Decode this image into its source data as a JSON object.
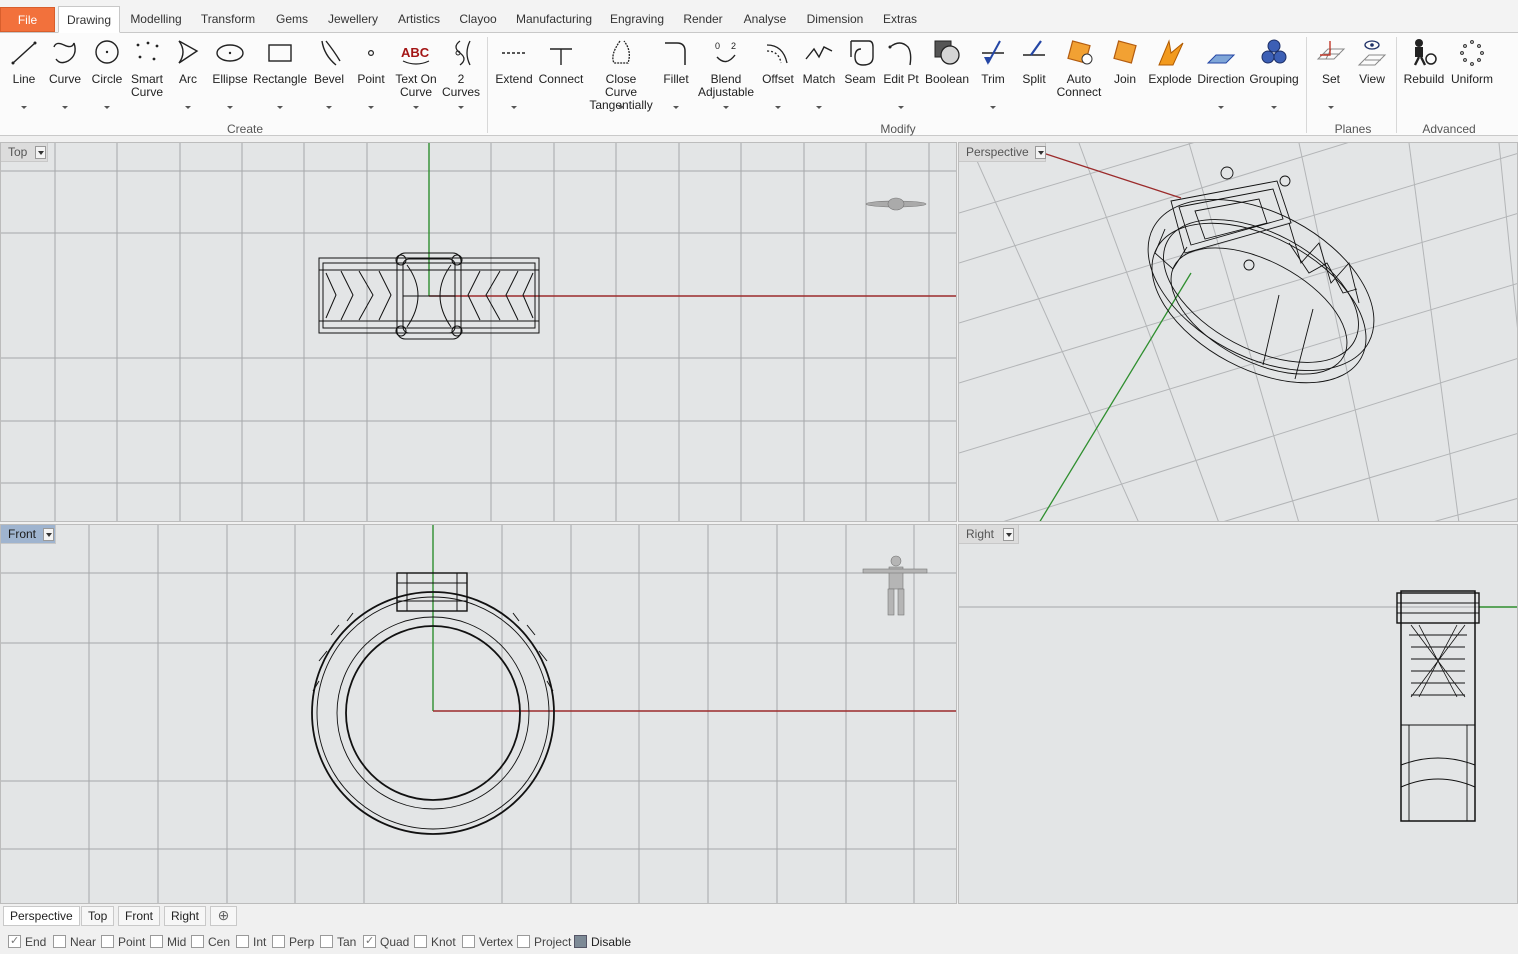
{
  "menu_tabs": [
    "File",
    "Drawing",
    "Modelling",
    "Transform",
    "Gems",
    "Jewellery",
    "Artistics",
    "Clayoo",
    "Manufacturing",
    "Engraving",
    "Render",
    "Analyse",
    "Dimension",
    "Extras"
  ],
  "active_menu_tab": "Drawing",
  "ribbon": {
    "create_buttons": [
      {
        "label": "Line",
        "icon": "line-icon"
      },
      {
        "label": "Curve",
        "icon": "curve-icon"
      },
      {
        "label": "Circle",
        "icon": "circle-icon"
      },
      {
        "label": "Smart\nCurve",
        "icon": "smart-curve-icon"
      },
      {
        "label": "Arc",
        "icon": "arc-icon"
      },
      {
        "label": "Ellipse",
        "icon": "ellipse-icon"
      },
      {
        "label": "Rectangle",
        "icon": "rectangle-icon"
      },
      {
        "label": "Bevel",
        "icon": "bevel-icon"
      },
      {
        "label": "Point",
        "icon": "point-icon"
      },
      {
        "label": "Text On\nCurve",
        "icon": "text-on-curve-icon"
      },
      {
        "label": "2\nCurves",
        "icon": "two-curves-icon"
      }
    ],
    "modify_buttons": [
      {
        "label": "Extend",
        "icon": "extend-icon"
      },
      {
        "label": "Connect",
        "icon": "connect-icon"
      },
      {
        "label": "Close Curve\nTangentially",
        "icon": "close-curve-icon"
      },
      {
        "label": "Fillet",
        "icon": "fillet-icon"
      },
      {
        "label": "Blend\nAdjustable",
        "icon": "blend-icon"
      },
      {
        "label": "Offset",
        "icon": "offset-icon"
      },
      {
        "label": "Match",
        "icon": "match-icon"
      },
      {
        "label": "Seam",
        "icon": "seam-icon"
      },
      {
        "label": "Edit Pt",
        "icon": "edit-point-icon"
      },
      {
        "label": "Boolean",
        "icon": "boolean-icon"
      },
      {
        "label": "Trim",
        "icon": "trim-icon"
      },
      {
        "label": "Split",
        "icon": "split-icon"
      },
      {
        "label": "Auto\nConnect",
        "icon": "auto-connect-icon"
      },
      {
        "label": "Join",
        "icon": "join-icon"
      },
      {
        "label": "Explode",
        "icon": "explode-icon"
      },
      {
        "label": "Direction",
        "icon": "direction-icon"
      },
      {
        "label": "Grouping",
        "icon": "grouping-icon"
      }
    ],
    "planes_buttons": [
      {
        "label": "Set",
        "icon": "set-plane-icon"
      },
      {
        "label": "View",
        "icon": "view-plane-icon"
      }
    ],
    "advanced_buttons": [
      {
        "label": "Rebuild",
        "icon": "rebuild-icon"
      },
      {
        "label": "Uniform",
        "icon": "uniform-icon"
      }
    ],
    "groups": [
      "Create",
      "Modify",
      "Planes",
      "Advanced"
    ]
  },
  "viewports": {
    "top": "Top",
    "perspective": "Perspective",
    "front": "Front",
    "right": "Right",
    "active": "Front"
  },
  "bottom_tabs": [
    "Perspective",
    "Top",
    "Front",
    "Right"
  ],
  "add_tab_icon": "add-tab-icon",
  "osnaps": [
    {
      "label": "End",
      "checked": true
    },
    {
      "label": "Near",
      "checked": false
    },
    {
      "label": "Point",
      "checked": false
    },
    {
      "label": "Mid",
      "checked": false
    },
    {
      "label": "Cen",
      "checked": false
    },
    {
      "label": "Int",
      "checked": false
    },
    {
      "label": "Perp",
      "checked": false
    },
    {
      "label": "Tan",
      "checked": false
    },
    {
      "label": "Quad",
      "checked": true
    },
    {
      "label": "Knot",
      "checked": false
    },
    {
      "label": "Vertex",
      "checked": false
    },
    {
      "label": "Project",
      "checked": false
    },
    {
      "label": "Disable",
      "checked": false
    }
  ],
  "colors": {
    "file_tab": "#f2713c",
    "x_axis": "#9b2b2b",
    "y_axis": "#2f8f2f",
    "active_viewport_label": "#9fb4cf"
  }
}
